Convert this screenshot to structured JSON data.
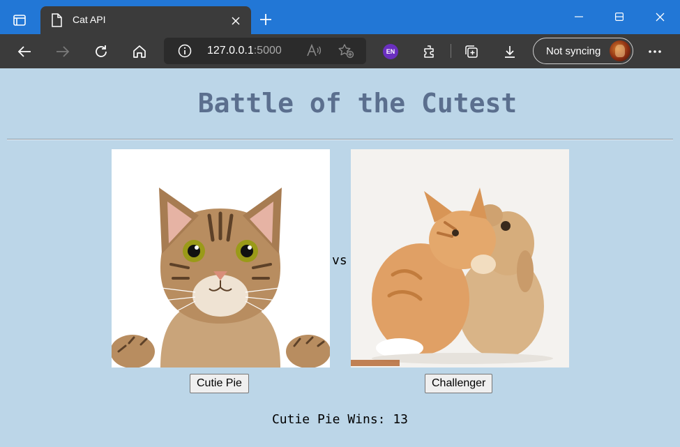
{
  "browser": {
    "tab_title": "Cat API",
    "url_host": "127.0.0.1",
    "url_port": ":5000",
    "extension_badge": "EN",
    "profile_label": "Not syncing"
  },
  "page": {
    "title": "Battle of the Cutest",
    "vs_label": "vs",
    "left_contestant": {
      "image": "tabby-cat-photo",
      "button_label": "Cutie Pie"
    },
    "right_contestant": {
      "image": "kitten-and-bunny-photo",
      "button_label": "Challenger"
    },
    "wins_text": "Cutie Pie Wins: 13"
  },
  "colors": {
    "page_background": "#bcd6e8",
    "title_color": "#5b6f8e",
    "titlebar": "#2277d6",
    "toolbar": "#3b3b3b"
  }
}
